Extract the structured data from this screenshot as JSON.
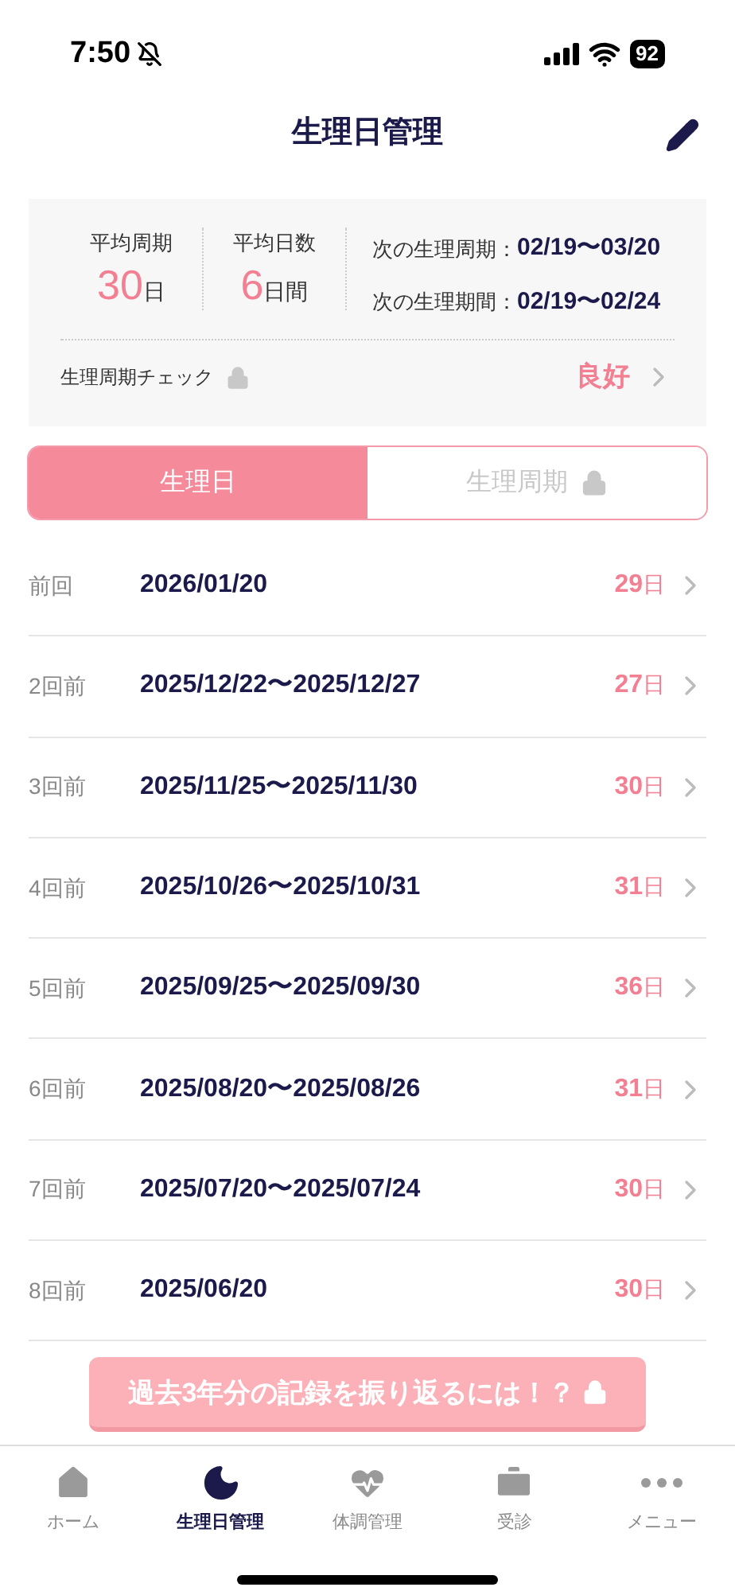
{
  "status_bar": {
    "time": "7:50",
    "battery": "92"
  },
  "header": {
    "title": "生理日管理"
  },
  "summary": {
    "stats": [
      {
        "label": "平均周期",
        "value": "30",
        "unit": "日"
      },
      {
        "label": "平均日数",
        "value": "6",
        "unit": "日間"
      }
    ],
    "next": [
      {
        "label": "次の生理周期：",
        "value": "02/19〜03/20"
      },
      {
        "label": "次の生理期間：",
        "value": "02/19〜02/24"
      }
    ],
    "check": {
      "label": "生理周期チェック",
      "locked": true,
      "result": "良好"
    }
  },
  "tabs": [
    {
      "label": "生理日",
      "selected": true,
      "locked": false
    },
    {
      "label": "生理周期",
      "selected": false,
      "locked": true
    }
  ],
  "records": [
    {
      "label": "前回",
      "dates": "2026/01/20",
      "days": "29",
      "unit": "日"
    },
    {
      "label": "2回前",
      "dates": "2025/12/22〜2025/12/27",
      "days": "27",
      "unit": "日"
    },
    {
      "label": "3回前",
      "dates": "2025/11/25〜2025/11/30",
      "days": "30",
      "unit": "日"
    },
    {
      "label": "4回前",
      "dates": "2025/10/26〜2025/10/31",
      "days": "31",
      "unit": "日"
    },
    {
      "label": "5回前",
      "dates": "2025/09/25〜2025/09/30",
      "days": "36",
      "unit": "日"
    },
    {
      "label": "6回前",
      "dates": "2025/08/20〜2025/08/26",
      "days": "31",
      "unit": "日"
    },
    {
      "label": "7回前",
      "dates": "2025/07/20〜2025/07/24",
      "days": "30",
      "unit": "日"
    },
    {
      "label": "8回前",
      "dates": "2025/06/20",
      "days": "30",
      "unit": "日"
    }
  ],
  "promo_button": {
    "label": "過去3年分の記録を振り返るには！？",
    "locked": true
  },
  "bottom_nav": [
    {
      "label": "ホーム",
      "kind": "home",
      "selected": false
    },
    {
      "label": "生理日管理",
      "kind": "moon",
      "selected": true
    },
    {
      "label": "体調管理",
      "kind": "heart",
      "selected": false
    },
    {
      "label": "受診",
      "kind": "clinic",
      "selected": false
    },
    {
      "label": "メニュー",
      "kind": "more",
      "selected": false
    }
  ]
}
